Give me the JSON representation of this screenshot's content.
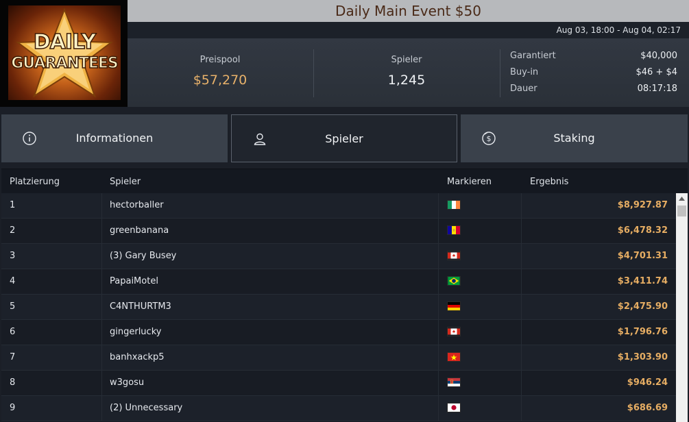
{
  "logo": {
    "line1": "DAILY",
    "line2": "GUARANTEES"
  },
  "title": "Daily Main Event $50",
  "date_range": "Aug 03, 18:00 - Aug 04, 02:17",
  "stats": {
    "prize_pool_label": "Preispool",
    "prize_pool_value": "$57,270",
    "players_label": "Spieler",
    "players_value": "1,245"
  },
  "details": [
    {
      "label": "Garantiert",
      "value": "$40,000"
    },
    {
      "label": "Buy-in",
      "value": "$46 + $4"
    },
    {
      "label": "Dauer",
      "value": "08:17:18"
    }
  ],
  "tabs": [
    {
      "label": "Informationen",
      "icon": "info-icon"
    },
    {
      "label": "Spieler",
      "icon": "user-icon",
      "active": true
    },
    {
      "label": "Staking",
      "icon": "dollar-icon"
    }
  ],
  "table": {
    "headers": {
      "place": "Platzierung",
      "player": "Spieler",
      "mark": "Markieren",
      "result": "Ergebnis"
    },
    "rows": [
      {
        "place": "1",
        "player": "hectorballer",
        "flag": "ireland",
        "result": "$8,927.87"
      },
      {
        "place": "2",
        "player": "greenbanana",
        "flag": "andorra",
        "result": "$6,478.32"
      },
      {
        "place": "3",
        "player": "(3) Gary Busey",
        "flag": "canada",
        "result": "$4,701.31"
      },
      {
        "place": "4",
        "player": "PapaiMotel",
        "flag": "brazil",
        "result": "$3,411.74"
      },
      {
        "place": "5",
        "player": "C4NTHURTM3",
        "flag": "germany",
        "result": "$2,475.90"
      },
      {
        "place": "6",
        "player": "gingerlucky",
        "flag": "canada",
        "result": "$1,796.76"
      },
      {
        "place": "7",
        "player": "banhxackp5",
        "flag": "vietnam",
        "result": "$1,303.90"
      },
      {
        "place": "8",
        "player": "w3gosu",
        "flag": "serbia",
        "result": "$946.24"
      },
      {
        "place": "9",
        "player": "(2) Unnecessary",
        "flag": "japan",
        "result": "$686.69"
      }
    ]
  },
  "colors": {
    "accent_gold": "#e7b16a",
    "title_text": "#4a2a18",
    "title_bar": "#b7b9bc"
  }
}
